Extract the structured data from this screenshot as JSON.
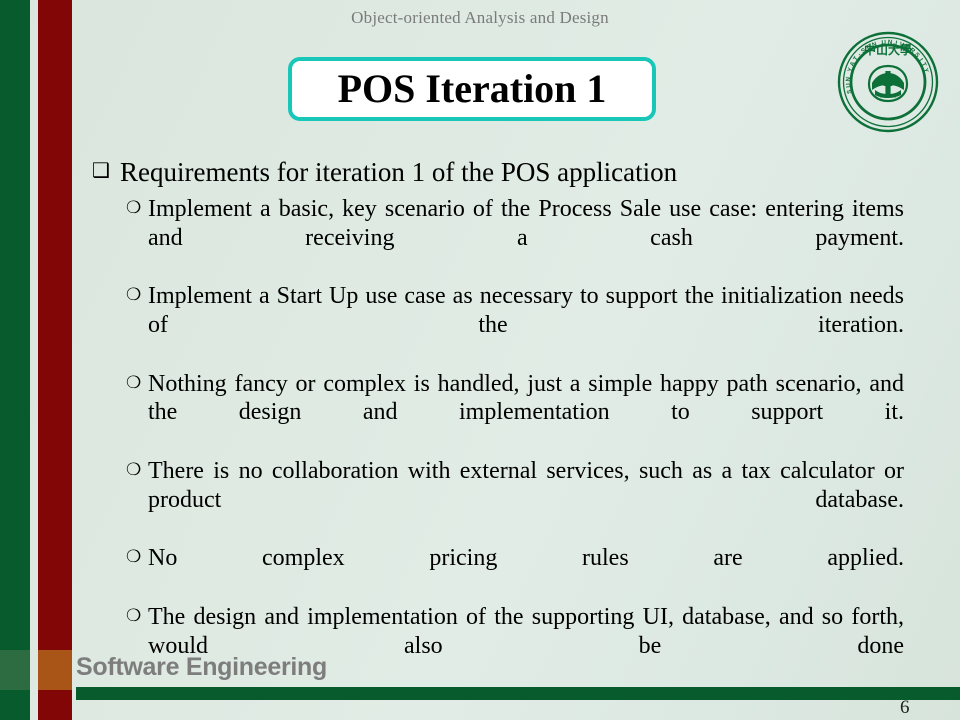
{
  "header": {
    "course_title": "Object-oriented Analysis and Design"
  },
  "logo": {
    "name": "sun-yat-sen-university-seal",
    "chinese_text": "中山大學",
    "rim_text": "SUN YAT-SEN UNIVERSITY",
    "color": "#0d7038"
  },
  "title": {
    "text": "POS Iteration 1",
    "border_color": "#19c7b8",
    "fill_color": "#ffffff"
  },
  "content": {
    "bullets": [
      {
        "marker": "❑",
        "marker_name": "hollow-square-bullet",
        "text": "Requirements for iteration 1 of the POS application",
        "children": [
          {
            "marker": "❍",
            "marker_name": "hollow-circle-bullet",
            "text": "Implement a basic, key scenario of the Process Sale use case: entering items and receiving a cash payment."
          },
          {
            "marker": "❍",
            "marker_name": "hollow-circle-bullet",
            "text": "Implement a Start Up use case as necessary to support the initialization needs of the iteration."
          },
          {
            "marker": "❍",
            "marker_name": "hollow-circle-bullet",
            "text": "Nothing fancy or complex is handled, just a simple happy path scenario, and the design and implementation to support it."
          },
          {
            "marker": "❍",
            "marker_name": "hollow-circle-bullet",
            "text": "There is no collaboration with external services, such as a tax calculator or product database."
          },
          {
            "marker": "❍",
            "marker_name": "hollow-circle-bullet",
            "text": "No complex pricing rules are applied."
          },
          {
            "marker": "❍",
            "marker_name": "hollow-circle-bullet",
            "text": "The design and implementation of the supporting UI, database, and so forth, would also be done"
          }
        ]
      }
    ]
  },
  "footer": {
    "label": "Software Engineering",
    "page_number": "6",
    "rule_color": "#075b2c"
  },
  "decor": {
    "green_bar_color": "#075b2c",
    "green_accent_color": "#2d6b40",
    "red_bar_color": "#820606",
    "orange_accent_color": "#a95517",
    "background_color": "#dde9e1"
  }
}
